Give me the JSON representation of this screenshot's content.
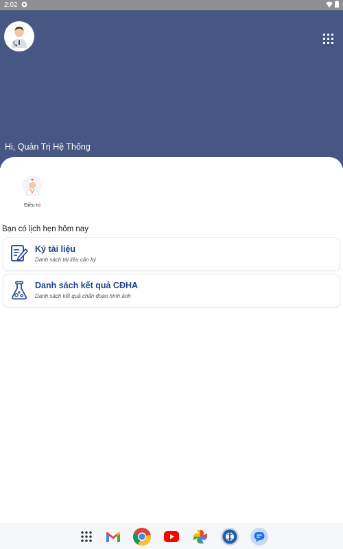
{
  "status_bar": {
    "time": "2:02"
  },
  "header": {
    "greeting": "Hi, Quản Trị Hệ Thống"
  },
  "features": [
    {
      "label": "Điều trị",
      "icon": "nurse-icon"
    }
  ],
  "section": {
    "title": "Bạn có lịch hẹn hôm nay"
  },
  "menu": [
    {
      "title": "Ký tài liệu",
      "subtitle": "Danh sách tài liệu cần ký",
      "icon": "document-sign-icon"
    },
    {
      "title": "Danh sách kết quả CĐHA",
      "subtitle": "Danh sách kết quả chẩn đoán hình ảnh",
      "icon": "lab-flask-icon"
    }
  ],
  "dock": [
    "app-drawer-icon",
    "gmail-icon",
    "chrome-icon",
    "youtube-icon",
    "photos-icon",
    "medical-app-icon",
    "messages-icon"
  ],
  "colors": {
    "header": "#475783",
    "accent": "#1f3f8f"
  }
}
